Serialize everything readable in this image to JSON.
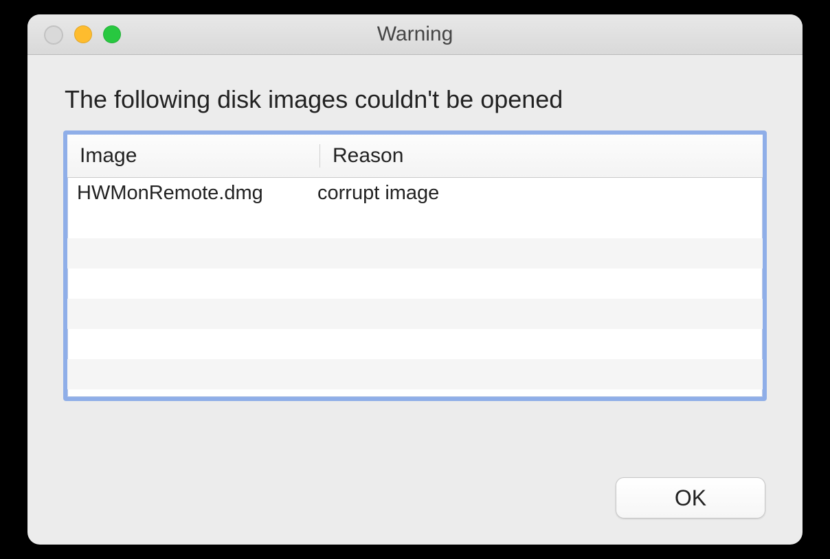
{
  "window": {
    "title": "Warning"
  },
  "message": "The following disk images couldn't be opened",
  "table": {
    "headers": {
      "image": "Image",
      "reason": "Reason"
    },
    "rows": [
      {
        "image": "HWMonRemote.dmg",
        "reason": "corrupt image"
      }
    ]
  },
  "buttons": {
    "ok": "OK"
  }
}
